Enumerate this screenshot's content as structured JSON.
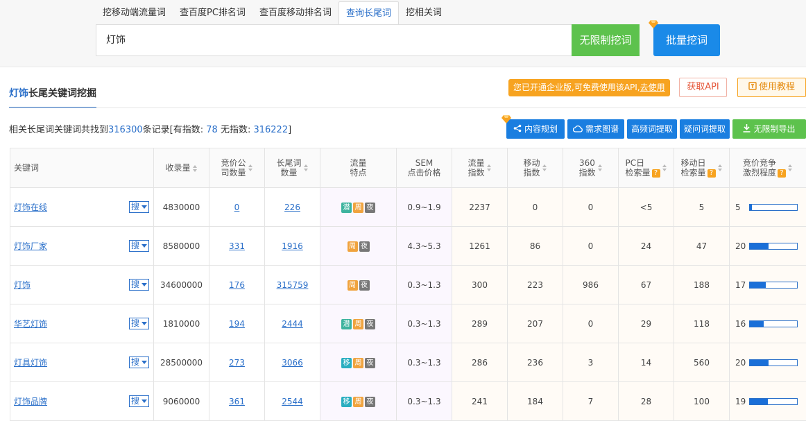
{
  "tabs": [
    "挖移动端流量词",
    "查百度PC排名词",
    "查百度移动排名词",
    "查询长尾词",
    "挖相关词"
  ],
  "search": {
    "value": "灯饰",
    "unlimited_label": "无限制挖词",
    "batch_label": "批量挖词"
  },
  "section": {
    "keyword": "灯饰",
    "title_suffix": "长尾关键词挖掘"
  },
  "notice": {
    "text": "您已开通企业版,可免费使用该API,",
    "link": "去使用"
  },
  "buttons": {
    "api": "获取API",
    "guide": "使用教程"
  },
  "summary": {
    "prefix": "相关长尾词关键词共找到",
    "total": "316300",
    "mid": "条记录[有指数:",
    "with_index": "78",
    "mid2": "无指数:",
    "without_index": "316222",
    "suffix": "]"
  },
  "toolbar": [
    "内容规划",
    "需求图谱",
    "高频词提取",
    "疑问词提取",
    "无限制导出"
  ],
  "columns": {
    "keyword": "关键词",
    "indexed": "收录量",
    "bid_1": "竞价公",
    "bid_2": "司数量",
    "long_1": "长尾词",
    "long_2": "数量",
    "feat_1": "流量",
    "feat_2": "特点",
    "sem_1": "SEM",
    "sem_2": "点击价格",
    "flow_1": "流量",
    "flow_2": "指数",
    "mobile_1": "移动",
    "mobile_2": "指数",
    "s360_1": "360",
    "s360_2": "指数",
    "pc_1": "PC日",
    "pc_2": "检索量",
    "mday_1": "移动日",
    "mday_2": "检索量",
    "comp_1": "竞价竞争",
    "comp_2": "激烈程度"
  },
  "search_btn_label": "搜",
  "rows": [
    {
      "kw_pre": "",
      "kw_hl": "灯饰",
      "kw_post": "在线",
      "indexed": "4830000",
      "bid": "0",
      "longtail": "226",
      "tags": [
        [
          "潜",
          "qian"
        ],
        [
          "周",
          "zhou"
        ],
        [
          "夜",
          "ye"
        ]
      ],
      "sem": "0.9~1.9",
      "flow": "2237",
      "mobile": "0",
      "s360": "0",
      "pc": "<5",
      "mday": "5",
      "comp": "5",
      "comp_pct": 5
    },
    {
      "kw_pre": "",
      "kw_hl": "灯饰",
      "kw_post": "厂家",
      "indexed": "8580000",
      "bid": "331",
      "longtail": "1916",
      "tags": [
        [
          "周",
          "zhou"
        ],
        [
          "夜",
          "ye"
        ]
      ],
      "sem": "4.3~5.3",
      "flow": "1261",
      "mobile": "86",
      "s360": "0",
      "pc": "24",
      "mday": "47",
      "comp": "20",
      "comp_pct": 40
    },
    {
      "kw_pre": "",
      "kw_hl": "灯饰",
      "kw_post": "",
      "indexed": "34600000",
      "bid": "176",
      "longtail": "315759",
      "tags": [
        [
          "周",
          "zhou"
        ],
        [
          "夜",
          "ye"
        ]
      ],
      "sem": "0.3~1.3",
      "flow": "300",
      "mobile": "223",
      "s360": "986",
      "pc": "67",
      "mday": "188",
      "comp": "17",
      "comp_pct": 34
    },
    {
      "kw_pre": "华艺",
      "kw_hl": "灯饰",
      "kw_post": "",
      "indexed": "1810000",
      "bid": "194",
      "longtail": "2444",
      "tags": [
        [
          "潜",
          "qian"
        ],
        [
          "周",
          "zhou"
        ],
        [
          "夜",
          "ye"
        ]
      ],
      "sem": "0.3~1.3",
      "flow": "289",
      "mobile": "207",
      "s360": "0",
      "pc": "29",
      "mday": "118",
      "comp": "16",
      "comp_pct": 30
    },
    {
      "kw_pre": "灯具",
      "kw_hl": "灯饰",
      "kw_post": "",
      "indexed": "28500000",
      "bid": "273",
      "longtail": "3066",
      "tags": [
        [
          "移",
          "yi"
        ],
        [
          "周",
          "zhou"
        ],
        [
          "夜",
          "ye"
        ]
      ],
      "sem": "0.3~1.3",
      "flow": "286",
      "mobile": "236",
      "s360": "3",
      "pc": "14",
      "mday": "560",
      "comp": "20",
      "comp_pct": 40
    },
    {
      "kw_pre": "",
      "kw_hl": "灯饰",
      "kw_post": "品牌",
      "indexed": "9060000",
      "bid": "361",
      "longtail": "2544",
      "tags": [
        [
          "移",
          "yi"
        ],
        [
          "周",
          "zhou"
        ],
        [
          "夜",
          "ye"
        ]
      ],
      "sem": "0.3~1.3",
      "flow": "241",
      "mobile": "184",
      "s360": "7",
      "pc": "28",
      "mday": "100",
      "comp": "19",
      "comp_pct": 38
    }
  ]
}
